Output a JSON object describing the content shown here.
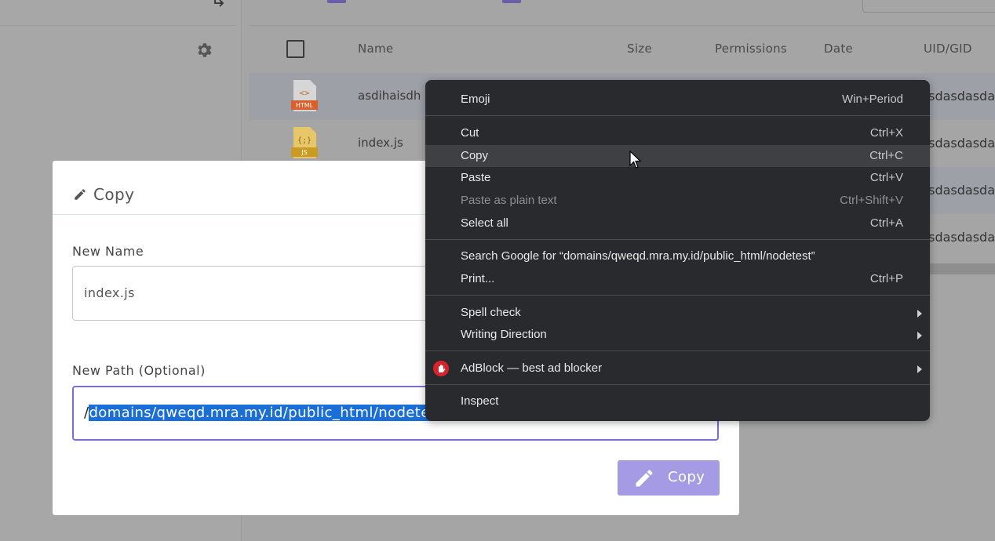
{
  "background": {
    "table_headers": [
      "Name",
      "Size",
      "Permissions",
      "Date",
      "UID/GID"
    ],
    "rows": [
      {
        "name": "asdihaisdh",
        "type": "HTML",
        "uid": "asdasdasda",
        "icon": "html-file-icon"
      },
      {
        "name": "index.js",
        "type": "JS",
        "uid": "asdasdasda",
        "icon": "js-file-icon"
      },
      {
        "name": "",
        "uid": "asdasdasda"
      },
      {
        "name": "",
        "uid": "asdasdasda"
      }
    ],
    "colors": {
      "accent": "#6b5ea8"
    }
  },
  "modal": {
    "title": "Copy",
    "new_name_label": "New Name",
    "new_name_value": "index.js",
    "new_path_label": "New Path (Optional)",
    "new_path_prefix": "/",
    "new_path_selected": "domains/qweqd.mra.my.id/public_html/nodetest",
    "copy_button": "Copy",
    "colors": {
      "button": "#a59be4",
      "focus": "#7d6cd6",
      "selection": "#1a6ed8"
    }
  },
  "context_menu": {
    "items": [
      {
        "label": "Emoji",
        "shortcut": "Win+Period"
      },
      {
        "label": "Cut",
        "shortcut": "Ctrl+X"
      },
      {
        "label": "Copy",
        "shortcut": "Ctrl+C"
      },
      {
        "label": "Paste",
        "shortcut": "Ctrl+V"
      },
      {
        "label": "Paste as plain text",
        "shortcut": "Ctrl+Shift+V"
      },
      {
        "label": "Select all",
        "shortcut": "Ctrl+A"
      },
      {
        "label": "Search Google for “domains/qweqd.mra.my.id/public_html/nodetest”",
        "shortcut": ""
      },
      {
        "label": "Print...",
        "shortcut": "Ctrl+P"
      },
      {
        "label": "Spell check",
        "shortcut": ""
      },
      {
        "label": "Writing Direction",
        "shortcut": ""
      },
      {
        "label": "AdBlock — best ad blocker",
        "shortcut": ""
      },
      {
        "label": "Inspect",
        "shortcut": ""
      }
    ],
    "colors": {
      "background": "#292a2d",
      "hover": "#3f4043"
    }
  }
}
